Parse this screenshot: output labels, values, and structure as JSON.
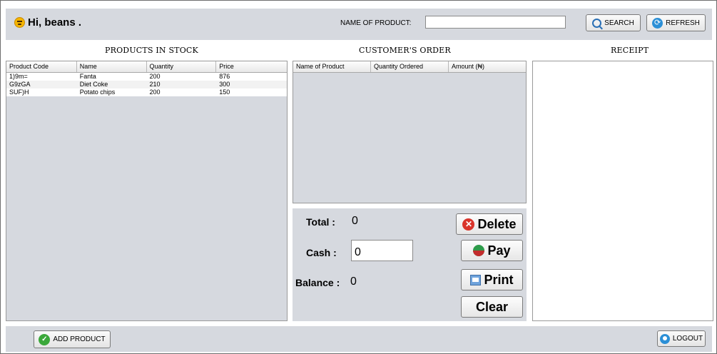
{
  "header": {
    "greeting": "Hi,  beans .",
    "name_of_product_label": "NAME OF PRODUCT:",
    "name_of_product_value": "",
    "search_label": "SEARCH",
    "refresh_label": "REFRESH"
  },
  "sections": {
    "stock_title": "PRODUCTS IN STOCK",
    "order_title": "CUSTOMER'S ORDER",
    "receipt_title": "RECEIPT"
  },
  "stock_table": {
    "columns": [
      "Product Code",
      "Name",
      "Quantity",
      "Price"
    ],
    "rows": [
      [
        "1)9m=",
        "Fanta",
        "200",
        "876"
      ],
      [
        "G9zGA",
        "Diet Coke",
        "210",
        "300"
      ],
      [
        "SUF)H",
        "Potato chips",
        "200",
        "150"
      ]
    ]
  },
  "order_table": {
    "columns": [
      "Name of Product",
      "Quantity Ordered",
      "Amount (₦)"
    ],
    "rows": []
  },
  "payment": {
    "total_label": "Total :",
    "total_value": "0",
    "cash_label": "Cash :",
    "cash_value": "0",
    "balance_label": "Balance :",
    "balance_value": "0",
    "delete_label": "Delete",
    "pay_label": "Pay",
    "print_label": "Print",
    "clear_label": "Clear"
  },
  "footer": {
    "add_product_label": "ADD PRODUCT",
    "logout_label": "LOGOUT"
  },
  "icons": {
    "greeting": "smiley-icon",
    "search": "search-icon",
    "refresh": "refresh-icon",
    "delete": "delete-icon",
    "pay": "pay-icon",
    "print": "print-icon",
    "add_product": "check-icon",
    "logout": "user-icon"
  },
  "colors": {
    "panel_bg": "#d6d9df",
    "delete_icon": "#d9342b",
    "check_icon": "#3aa83a",
    "accent_blue": "#2b8fd6"
  }
}
